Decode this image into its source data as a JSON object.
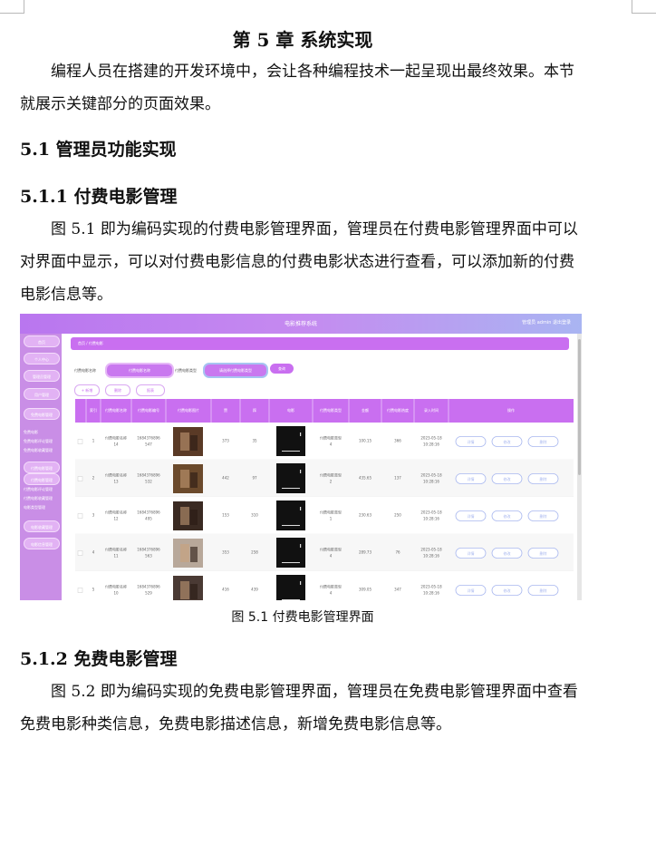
{
  "chapter_title": "第 5 章  系统实现",
  "intro": "编程人员在搭建的开发环境中，会让各种编程技术一起呈现出最终效果。本节就展示关键部分的页面效果。",
  "sec_5_1": "5.1  管理员功能实现",
  "sec_5_1_1": "5.1.1  付费电影管理",
  "para_5_1_1": "图 5.1  即为编码实现的付费电影管理界面，管理员在付费电影管理界面中可以对界面中显示，可以对付费电影信息的付费电影状态进行查看，可以添加新的付费电影信息等。",
  "figure_caption": "图 5.1  付费电影管理界面",
  "sec_5_1_2": "5.1.2  免费电影管理",
  "para_5_1_2": "图 5.2  即为编码实现的免费电影管理界面，管理员在免费电影管理界面中查看免费电影种类信息，免费电影描述信息，新增免费电影信息等。",
  "screenshot": {
    "app_title": "电影推荐系统",
    "user_text": "管理员 admin    退出登录",
    "breadcrumb": "首页  /  付费电影",
    "sidebar": [
      "首页",
      "个人中心",
      "管理员管理",
      "用户管理",
      "免费电影管理",
      "免费电影",
      "免费电影评论管理",
      "免费电影收藏管理",
      "付费电影管理",
      "付费电影管理",
      "付费电影评论管理",
      "付费电影收藏管理",
      "电影类型管理",
      "电影收藏管理",
      "电影信息管理"
    ],
    "filter_name_label": "付费电影名称",
    "filter_name_placeholder": "付费电影名称",
    "filter_type_label": "付费电影类型",
    "filter_type_placeholder": "请选择付费电影类型",
    "search_btn": "查询",
    "add_btn": "+ 新增",
    "delete_btn": "删除",
    "report_btn": "报表",
    "columns": [
      "",
      "索引",
      "付费电影名称",
      "付费电影编号",
      "付费电影图片",
      "赞",
      "踩",
      "电影",
      "付费电影类型",
      "金额",
      "付费电影热度",
      "录入时间",
      "操作"
    ],
    "row_actions": [
      "详情",
      "修改",
      "删除"
    ],
    "rows": [
      {
        "idx": "1",
        "name": "付费电影名称14",
        "code": "1684376896547",
        "like": "373",
        "dislike": "35",
        "type": "付费电影类型4",
        "price": "100.15",
        "heat": "366",
        "time": "2023-05-18 10:28:16"
      },
      {
        "idx": "2",
        "name": "付费电影名称13",
        "code": "1684376896532",
        "like": "442",
        "dislike": "97",
        "type": "付费电影类型2",
        "price": "435.65",
        "heat": "137",
        "time": "2023-05-18 10:28:16"
      },
      {
        "idx": "3",
        "name": "付费电影名称12",
        "code": "1684376896495",
        "like": "153",
        "dislike": "310",
        "type": "付费电影类型1",
        "price": "230.63",
        "heat": "250",
        "time": "2023-05-18 10:28:16"
      },
      {
        "idx": "4",
        "name": "付费电影名称11",
        "code": "1684376896563",
        "like": "353",
        "dislike": "258",
        "type": "付费电影类型4",
        "price": "289.73",
        "heat": "76",
        "time": "2023-05-18 10:28:16"
      },
      {
        "idx": "5",
        "name": "付费电影名称10",
        "code": "1684376896529",
        "like": "416",
        "dislike": "439",
        "type": "付费电影类型4",
        "price": "309.05",
        "heat": "347",
        "time": "2023-05-18 10:28:16"
      }
    ]
  }
}
